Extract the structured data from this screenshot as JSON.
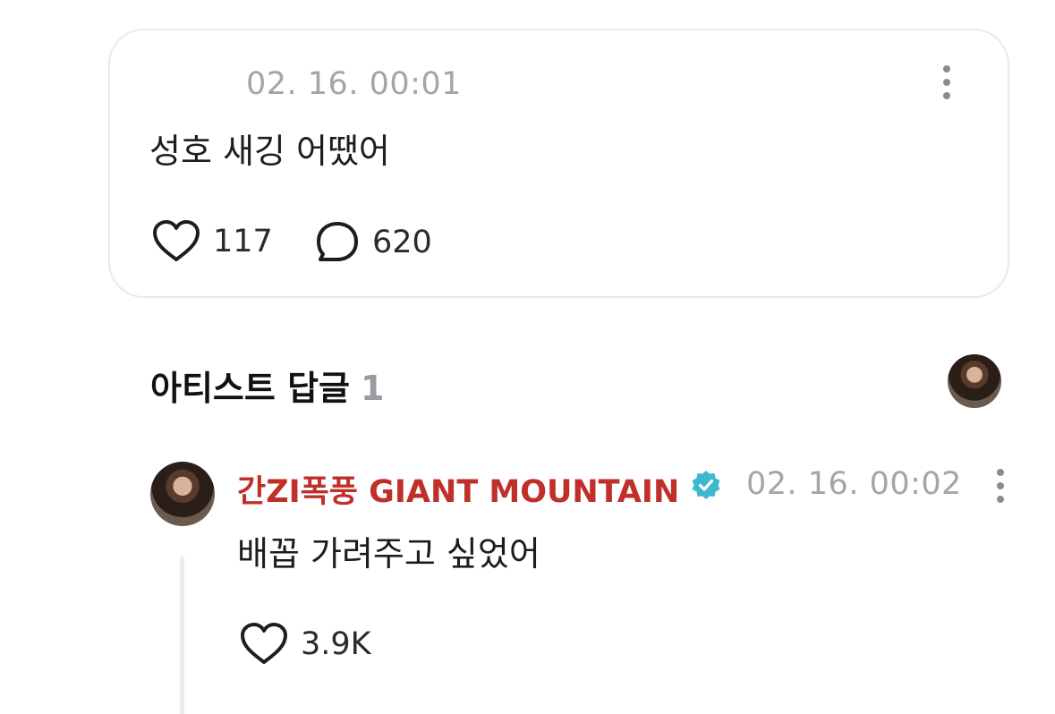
{
  "post": {
    "timestamp": "02. 16. 00:01",
    "body": "성호 새깅 어땠어",
    "likes": "117",
    "comments": "620"
  },
  "section": {
    "title": "아티스트 답글",
    "count": "1"
  },
  "reply": {
    "author": "간ZI폭풍 GIANT MOUNTAIN",
    "verified": true,
    "timestamp": "02. 16. 00:02",
    "body": "배꼽 가려주고 싶었어",
    "likes": "3.9K"
  },
  "colors": {
    "author_name": "#c0302a",
    "verified_badge": "#3cb8cf",
    "muted_text": "#a4a4aa"
  },
  "icons": [
    "more-vertical-icon",
    "heart-icon",
    "comment-bubble-icon",
    "verified-badge-icon",
    "avatar"
  ]
}
